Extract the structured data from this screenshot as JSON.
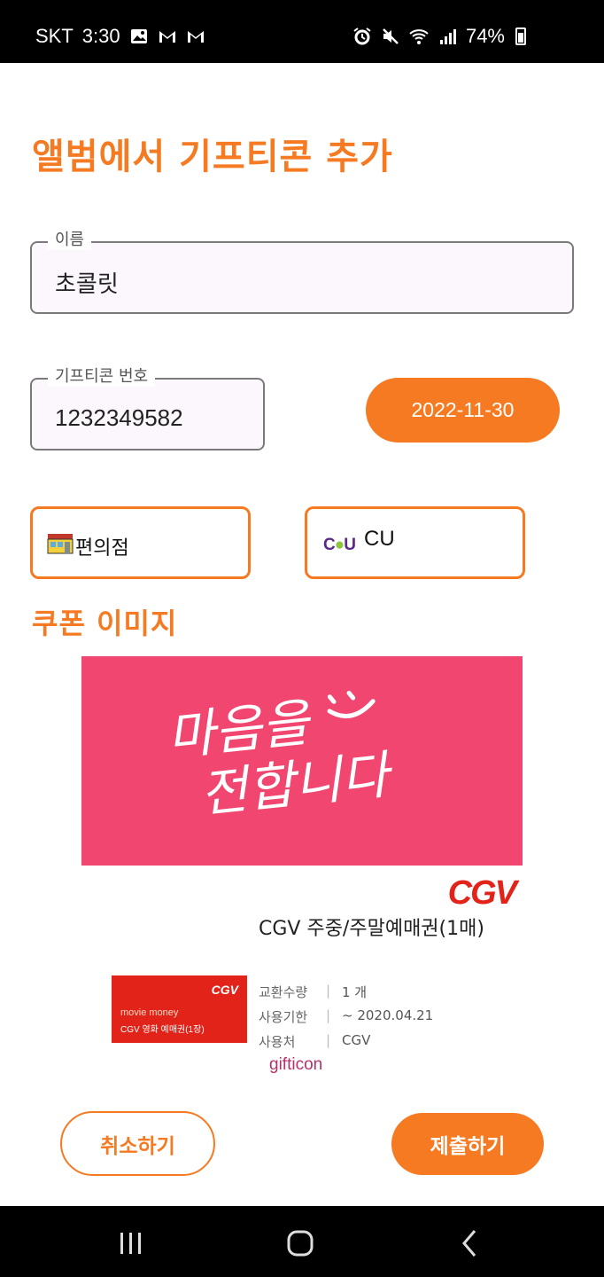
{
  "status_bar": {
    "carrier": "SKT",
    "time": "3:30",
    "battery": "74%"
  },
  "page": {
    "title": "앨범에서 기프티콘 추가"
  },
  "form": {
    "name_label": "이름",
    "name_value": "초콜릿",
    "code_label": "기프티콘 번호",
    "code_value": "1232349582",
    "date_button": "2022-11-30",
    "category_label": "편의점",
    "brand_label": "CU",
    "brand_logo_text": "CU"
  },
  "coupon_section": {
    "title": "쿠폰 이미지"
  },
  "coupon_image": {
    "banner_line1": "마음을",
    "banner_line2": "전합니다",
    "brand_logo": "CGV",
    "card_logo": "CGV",
    "card_line1": "movie money",
    "card_line2": "CGV 영화 예매권(1장)",
    "product_name": "CGV 주중/주말예매권(1매)",
    "rows": [
      {
        "key": "교환수량",
        "value": "1 개"
      },
      {
        "key": "사용기한",
        "value": "~ 2020.04.21"
      },
      {
        "key": "사용처",
        "value": "CGV"
      }
    ],
    "footer_brand": "gifticon"
  },
  "actions": {
    "cancel_label": "취소하기",
    "submit_label": "제출하기"
  },
  "colors": {
    "accent": "#f57a22",
    "banner": "#f0466f",
    "cgv_red": "#e2231a"
  },
  "icons": {
    "status": [
      "image-icon",
      "gmail-icon",
      "gmail-icon",
      "alarm-icon",
      "mute-icon",
      "wifi-icon",
      "signal-icon",
      "battery-icon"
    ],
    "nav": [
      "recent-apps-icon",
      "home-icon",
      "back-icon"
    ]
  }
}
